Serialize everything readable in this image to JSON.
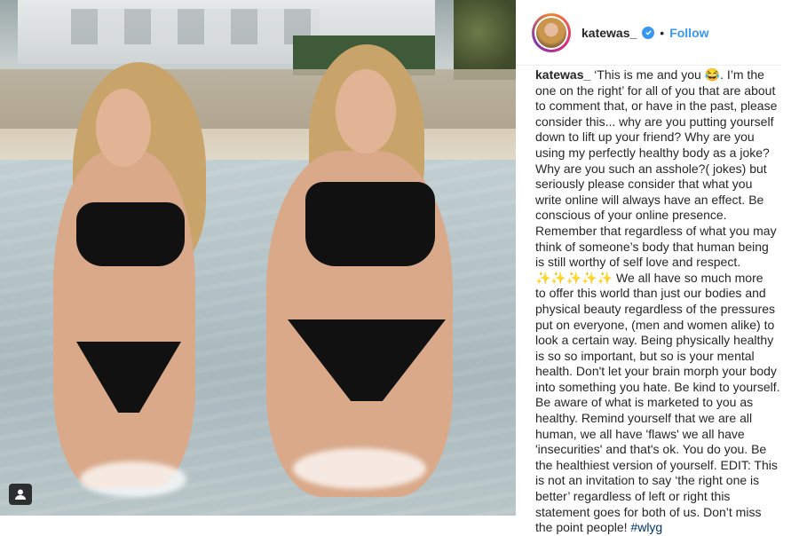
{
  "post": {
    "photo_alt": "",
    "tag_icon": "person-tag-icon"
  },
  "header": {
    "username": "katewas_",
    "verified_icon": "verified-badge-icon",
    "separator": "•",
    "follow_label": "Follow"
  },
  "caption": {
    "username": "katewas_",
    "lines": [
      "‘This is me and you 😂. I’m the",
      "one on the right’ for all of you that are about",
      "to comment that, or have in the past, please",
      "consider this... why are you putting yourself",
      "down to lift up your friend? Why are you",
      "using my perfectly healthy body as a joke?",
      "Why are you such an asshole?( jokes) but",
      "seriously please consider that what you",
      "write online will always have an effect. Be",
      "conscious of your online presence.",
      "Remember that regardless of what you may",
      "think of someone’s body that human being",
      "is still worthy of self love and respect.",
      "✨✨✨✨✨ We all have so much more",
      "to offer this world than just our bodies and",
      "physical beauty regardless of the pressures",
      "put on everyone, (men and women alike) to",
      "look a certain way. Being physically healthy",
      "is so so important, but so is your mental",
      "health. Don't let your brain morph your body",
      "into something you hate. Be kind to yourself.",
      "Be aware of what is marketed to you as",
      "healthy. Remind yourself that we are all",
      "human, we all have 'flaws' we all have",
      "'insecurities' and that's ok. You do you. Be",
      "the healthiest version of yourself. EDIT: This",
      "is not an invitation to say ‘the right one is",
      "better’ regardless of left or right this",
      "statement goes for both of us. Don’t miss",
      "the point people!"
    ],
    "hashtag": "#wlyg"
  },
  "colors": {
    "link": "#3897f0",
    "text": "#262626",
    "hashtag": "#003569"
  }
}
